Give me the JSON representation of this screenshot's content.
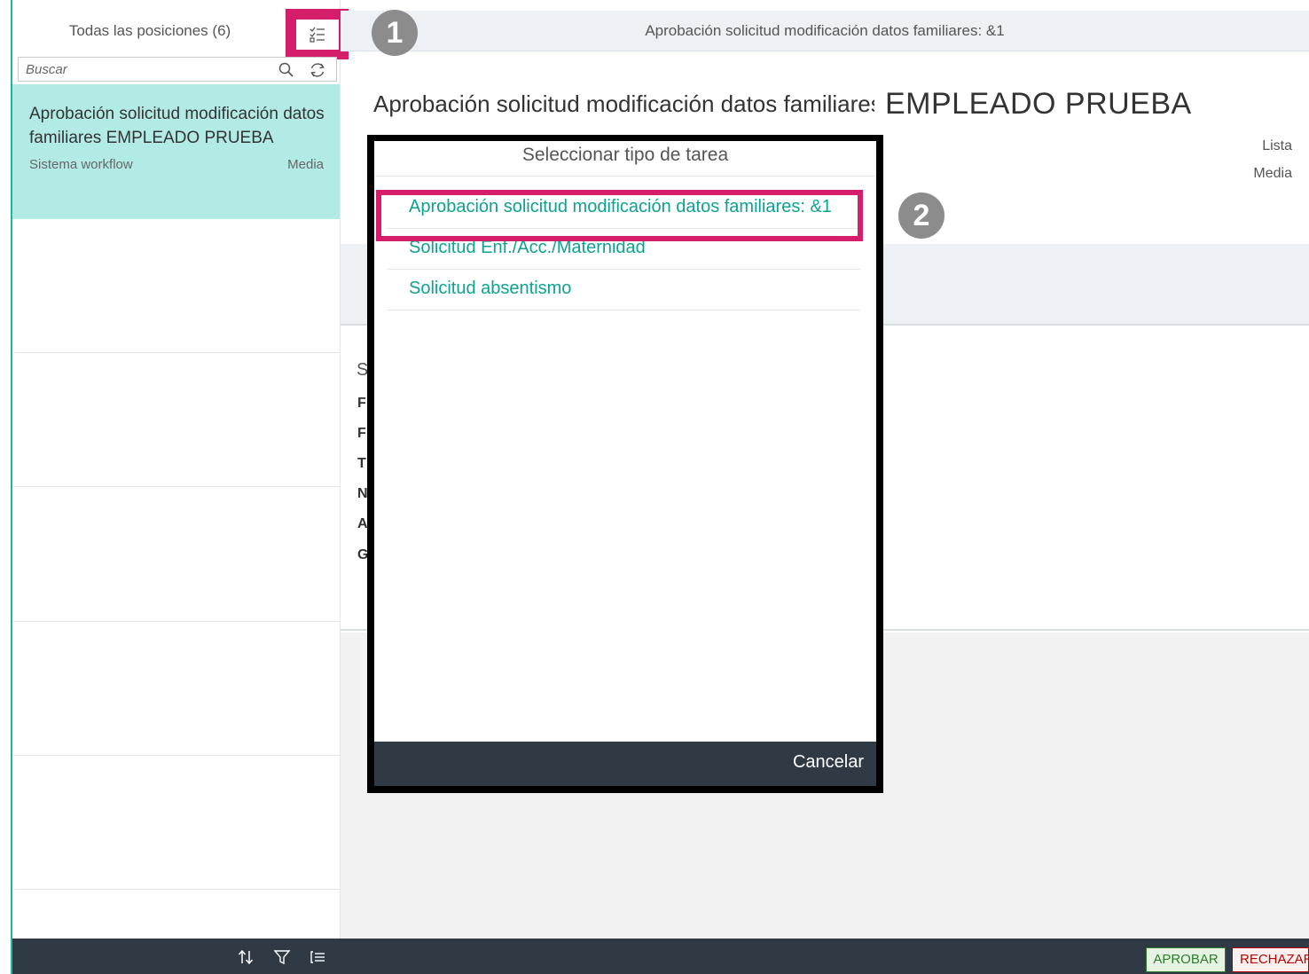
{
  "master": {
    "title": "Todas las posiciones (6)",
    "search_placeholder": "Buscar",
    "item": {
      "title": "Aprobación solicitud modificación datos familiares EMPLEADO PRUEBA",
      "subtitle": "Sistema workflow",
      "priority": "Media"
    }
  },
  "detail": {
    "header_title": "Aprobación solicitud modificación datos familiares: &1",
    "object_title_prefix": "Aprobación solicitud modificación datos familiares:",
    "object_title_name": "EMPLEADO PRUEBA",
    "attribute_1": "Lista",
    "attribute_2": "Media",
    "form_heading_letter": "S",
    "form_letters": [
      "F",
      "F",
      "T",
      "N",
      "A",
      "G"
    ],
    "approve_label": "APROBAR",
    "reject_label": "RECHAZAR"
  },
  "badges": {
    "step1": "1",
    "step2": "2"
  },
  "dialog": {
    "title": "Seleccionar tipo de tarea",
    "items": [
      "Aprobación solicitud modificación datos familiares: &1",
      "Solicitud Enf./Acc./Maternidad",
      "Solicitud absentismo"
    ],
    "cancel_label": "Cancelar"
  },
  "colors": {
    "highlight": "#d61d6b",
    "accent": "#1fb5a3",
    "link": "#0ba391",
    "footer": "#2f3a45",
    "selected_item": "#b2ebe6"
  },
  "icons": [
    "filter-list-icon",
    "search-icon",
    "refresh-icon",
    "sort-icon",
    "filter-icon",
    "group-icon"
  ]
}
